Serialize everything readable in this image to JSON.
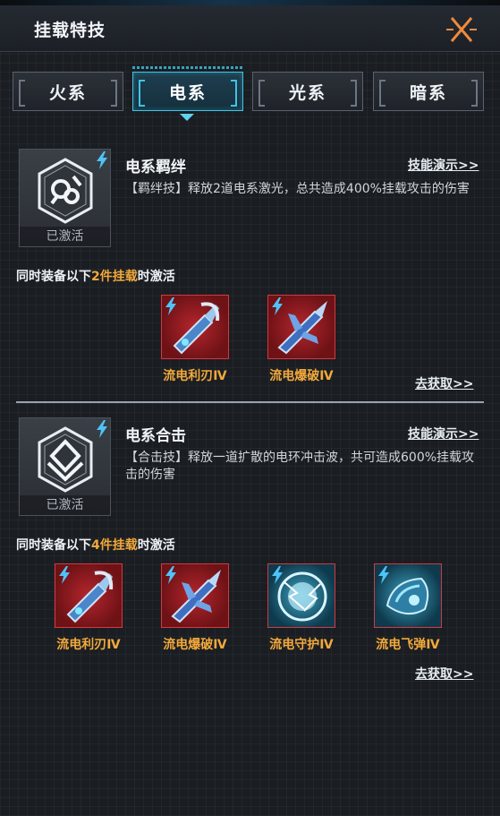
{
  "header": {
    "title": "挂载特技"
  },
  "tabs": [
    {
      "label": "火系",
      "active": false
    },
    {
      "label": "电系",
      "active": true
    },
    {
      "label": "光系",
      "active": false
    },
    {
      "label": "暗系",
      "active": false
    }
  ],
  "colors": {
    "accent": "#3ec4e6",
    "highlight": "#f2a93b",
    "item_red": "#b5262d"
  },
  "sections": [
    {
      "status": "已激活",
      "icon": "electric-bond-emblem-icon",
      "title": "电系羁绊",
      "demo_link": "技能演示>>",
      "description": "【羁绊技】释放2道电系激光，总共造成400%挂载攻击的伤害",
      "requirement": {
        "prefix": "同时装备以下",
        "count": "2件挂载",
        "suffix": "时激活"
      },
      "items": [
        {
          "name": "流电利刃Ⅳ",
          "icon": "blade-drone-icon"
        },
        {
          "name": "流电爆破Ⅳ",
          "icon": "blast-jet-icon"
        }
      ],
      "get_link": "去获取>>"
    },
    {
      "status": "已激活",
      "icon": "combo-strike-emblem-icon",
      "title": "电系合击",
      "demo_link": "技能演示>>",
      "description": "【合击技】释放一道扩散的电环冲击波，共可造成600%挂载攻击的伤害",
      "requirement": {
        "prefix": "同时装备以下",
        "count": "4件挂载",
        "suffix": "时激活"
      },
      "items": [
        {
          "name": "流电利刃Ⅳ",
          "icon": "blade-drone-icon"
        },
        {
          "name": "流电爆破Ⅳ",
          "icon": "blast-jet-icon"
        },
        {
          "name": "流电守护Ⅳ",
          "icon": "energy-shield-icon"
        },
        {
          "name": "流电飞弹Ⅳ",
          "icon": "missile-pod-icon"
        }
      ],
      "get_link": "去获取>>"
    }
  ]
}
